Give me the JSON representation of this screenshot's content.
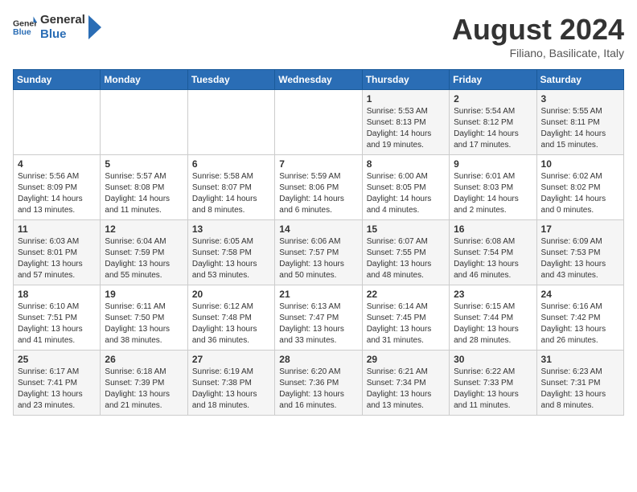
{
  "header": {
    "logo_general": "General",
    "logo_blue": "Blue",
    "month_title": "August 2024",
    "subtitle": "Filiano, Basilicate, Italy"
  },
  "days_of_week": [
    "Sunday",
    "Monday",
    "Tuesday",
    "Wednesday",
    "Thursday",
    "Friday",
    "Saturday"
  ],
  "weeks": [
    {
      "days": [
        {
          "num": "",
          "info": ""
        },
        {
          "num": "",
          "info": ""
        },
        {
          "num": "",
          "info": ""
        },
        {
          "num": "",
          "info": ""
        },
        {
          "num": "1",
          "info": "Sunrise: 5:53 AM\nSunset: 8:13 PM\nDaylight: 14 hours\nand 19 minutes."
        },
        {
          "num": "2",
          "info": "Sunrise: 5:54 AM\nSunset: 8:12 PM\nDaylight: 14 hours\nand 17 minutes."
        },
        {
          "num": "3",
          "info": "Sunrise: 5:55 AM\nSunset: 8:11 PM\nDaylight: 14 hours\nand 15 minutes."
        }
      ]
    },
    {
      "days": [
        {
          "num": "4",
          "info": "Sunrise: 5:56 AM\nSunset: 8:09 PM\nDaylight: 14 hours\nand 13 minutes."
        },
        {
          "num": "5",
          "info": "Sunrise: 5:57 AM\nSunset: 8:08 PM\nDaylight: 14 hours\nand 11 minutes."
        },
        {
          "num": "6",
          "info": "Sunrise: 5:58 AM\nSunset: 8:07 PM\nDaylight: 14 hours\nand 8 minutes."
        },
        {
          "num": "7",
          "info": "Sunrise: 5:59 AM\nSunset: 8:06 PM\nDaylight: 14 hours\nand 6 minutes."
        },
        {
          "num": "8",
          "info": "Sunrise: 6:00 AM\nSunset: 8:05 PM\nDaylight: 14 hours\nand 4 minutes."
        },
        {
          "num": "9",
          "info": "Sunrise: 6:01 AM\nSunset: 8:03 PM\nDaylight: 14 hours\nand 2 minutes."
        },
        {
          "num": "10",
          "info": "Sunrise: 6:02 AM\nSunset: 8:02 PM\nDaylight: 14 hours\nand 0 minutes."
        }
      ]
    },
    {
      "days": [
        {
          "num": "11",
          "info": "Sunrise: 6:03 AM\nSunset: 8:01 PM\nDaylight: 13 hours\nand 57 minutes."
        },
        {
          "num": "12",
          "info": "Sunrise: 6:04 AM\nSunset: 7:59 PM\nDaylight: 13 hours\nand 55 minutes."
        },
        {
          "num": "13",
          "info": "Sunrise: 6:05 AM\nSunset: 7:58 PM\nDaylight: 13 hours\nand 53 minutes."
        },
        {
          "num": "14",
          "info": "Sunrise: 6:06 AM\nSunset: 7:57 PM\nDaylight: 13 hours\nand 50 minutes."
        },
        {
          "num": "15",
          "info": "Sunrise: 6:07 AM\nSunset: 7:55 PM\nDaylight: 13 hours\nand 48 minutes."
        },
        {
          "num": "16",
          "info": "Sunrise: 6:08 AM\nSunset: 7:54 PM\nDaylight: 13 hours\nand 46 minutes."
        },
        {
          "num": "17",
          "info": "Sunrise: 6:09 AM\nSunset: 7:53 PM\nDaylight: 13 hours\nand 43 minutes."
        }
      ]
    },
    {
      "days": [
        {
          "num": "18",
          "info": "Sunrise: 6:10 AM\nSunset: 7:51 PM\nDaylight: 13 hours\nand 41 minutes."
        },
        {
          "num": "19",
          "info": "Sunrise: 6:11 AM\nSunset: 7:50 PM\nDaylight: 13 hours\nand 38 minutes."
        },
        {
          "num": "20",
          "info": "Sunrise: 6:12 AM\nSunset: 7:48 PM\nDaylight: 13 hours\nand 36 minutes."
        },
        {
          "num": "21",
          "info": "Sunrise: 6:13 AM\nSunset: 7:47 PM\nDaylight: 13 hours\nand 33 minutes."
        },
        {
          "num": "22",
          "info": "Sunrise: 6:14 AM\nSunset: 7:45 PM\nDaylight: 13 hours\nand 31 minutes."
        },
        {
          "num": "23",
          "info": "Sunrise: 6:15 AM\nSunset: 7:44 PM\nDaylight: 13 hours\nand 28 minutes."
        },
        {
          "num": "24",
          "info": "Sunrise: 6:16 AM\nSunset: 7:42 PM\nDaylight: 13 hours\nand 26 minutes."
        }
      ]
    },
    {
      "days": [
        {
          "num": "25",
          "info": "Sunrise: 6:17 AM\nSunset: 7:41 PM\nDaylight: 13 hours\nand 23 minutes."
        },
        {
          "num": "26",
          "info": "Sunrise: 6:18 AM\nSunset: 7:39 PM\nDaylight: 13 hours\nand 21 minutes."
        },
        {
          "num": "27",
          "info": "Sunrise: 6:19 AM\nSunset: 7:38 PM\nDaylight: 13 hours\nand 18 minutes."
        },
        {
          "num": "28",
          "info": "Sunrise: 6:20 AM\nSunset: 7:36 PM\nDaylight: 13 hours\nand 16 minutes."
        },
        {
          "num": "29",
          "info": "Sunrise: 6:21 AM\nSunset: 7:34 PM\nDaylight: 13 hours\nand 13 minutes."
        },
        {
          "num": "30",
          "info": "Sunrise: 6:22 AM\nSunset: 7:33 PM\nDaylight: 13 hours\nand 11 minutes."
        },
        {
          "num": "31",
          "info": "Sunrise: 6:23 AM\nSunset: 7:31 PM\nDaylight: 13 hours\nand 8 minutes."
        }
      ]
    }
  ]
}
